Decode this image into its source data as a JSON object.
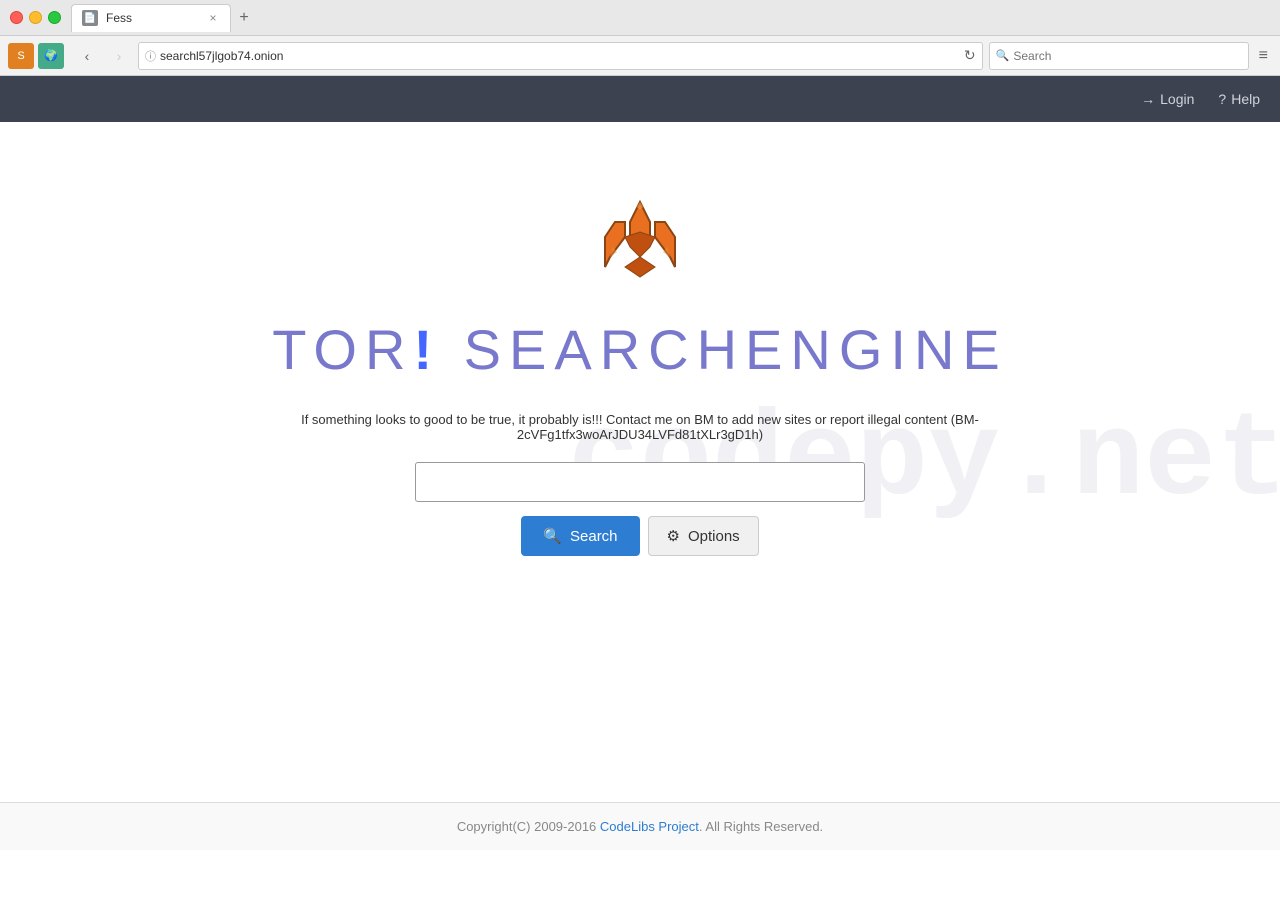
{
  "browser": {
    "tab_title": "Fess",
    "tab_icon": "📄",
    "url": "searchl57jlgob74.onion",
    "search_placeholder": "Search",
    "menu_icon": "≡"
  },
  "navbar": {
    "login_label": "Login",
    "help_label": "Help"
  },
  "watermark": "codepy.net",
  "site": {
    "title_part1": "TOR",
    "exclamation": "!",
    "title_part2": "SEARCHENGINE",
    "disclaimer": "If something looks to good to be true, it probably is!!! Contact me on BM to add new sites or report illegal content (BM-2cVFg1tfx3woArJDU34LVFd81tXLr3gD1h)",
    "search_button": "Search",
    "options_button": "Options"
  },
  "footer": {
    "text_before": "Copyright(C) 2009-2016 ",
    "link_text": "CodeLibs Project",
    "text_after": ". All Rights Reserved."
  }
}
